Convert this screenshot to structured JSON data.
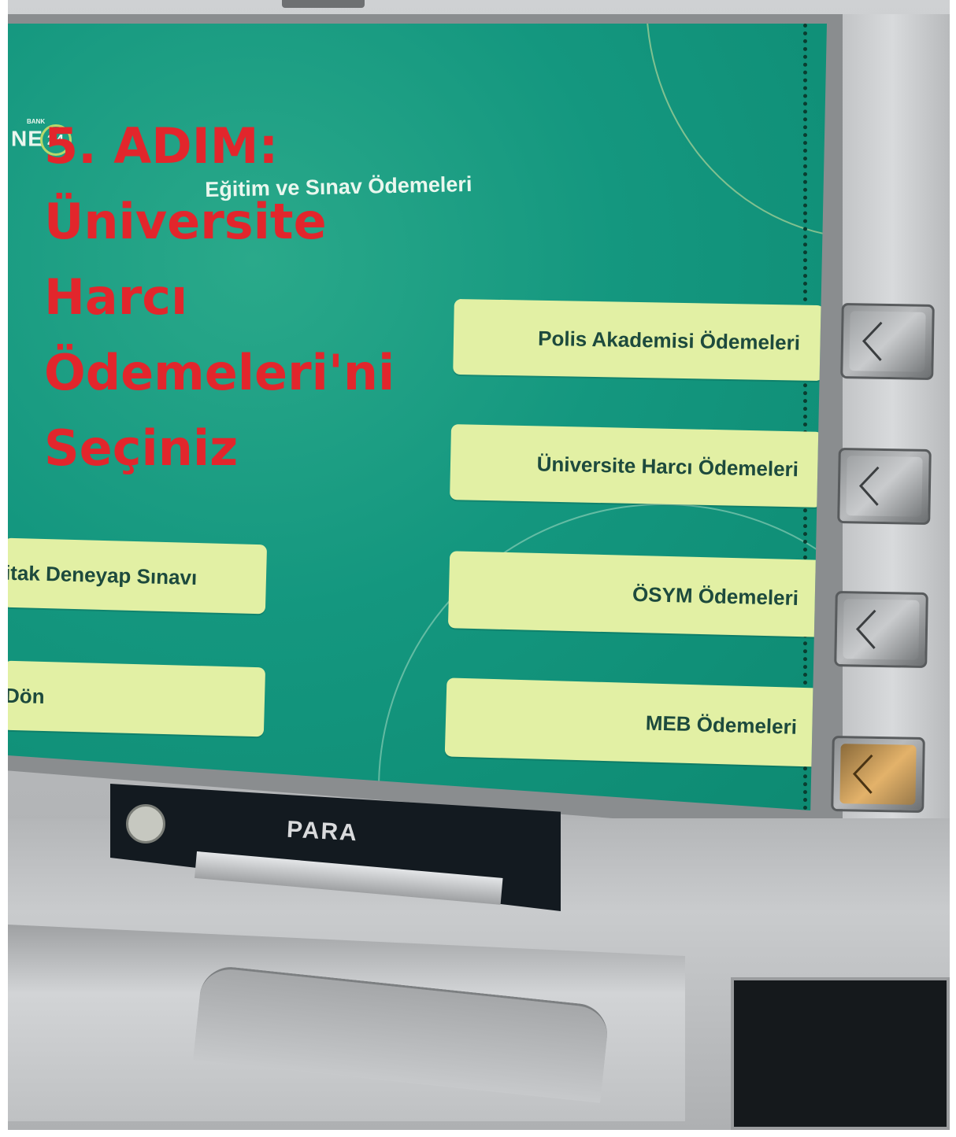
{
  "screen": {
    "logo_text": "NE",
    "logo_number": "24",
    "logo_small": "BANK",
    "title": "Eğitim ve Sınav Ödemeleri",
    "menu_right": [
      "Polis Akademisi Ödemeleri",
      "Üniversite Harcı Ödemeleri",
      "ÖSYM Ödemeleri",
      "MEB Ödemeleri"
    ],
    "menu_left": [
      "itak Deneyap Sınavı",
      " Dön"
    ]
  },
  "machine": {
    "cash_slot_label": "PARA",
    "hardware_buttons": [
      "chevron-left-icon",
      "chevron-left-icon",
      "chevron-left-icon",
      "chevron-left-icon"
    ]
  },
  "overlay": {
    "lines": [
      "5. ADIM:",
      "Üniversite",
      "Harcı",
      "Ödemeleri'ni",
      "Seçiniz"
    ],
    "color": "#e2262c"
  },
  "colors": {
    "screen_bg": "#14977f",
    "button_bg": "#e2f0a4",
    "button_text": "#1d4a3d"
  }
}
